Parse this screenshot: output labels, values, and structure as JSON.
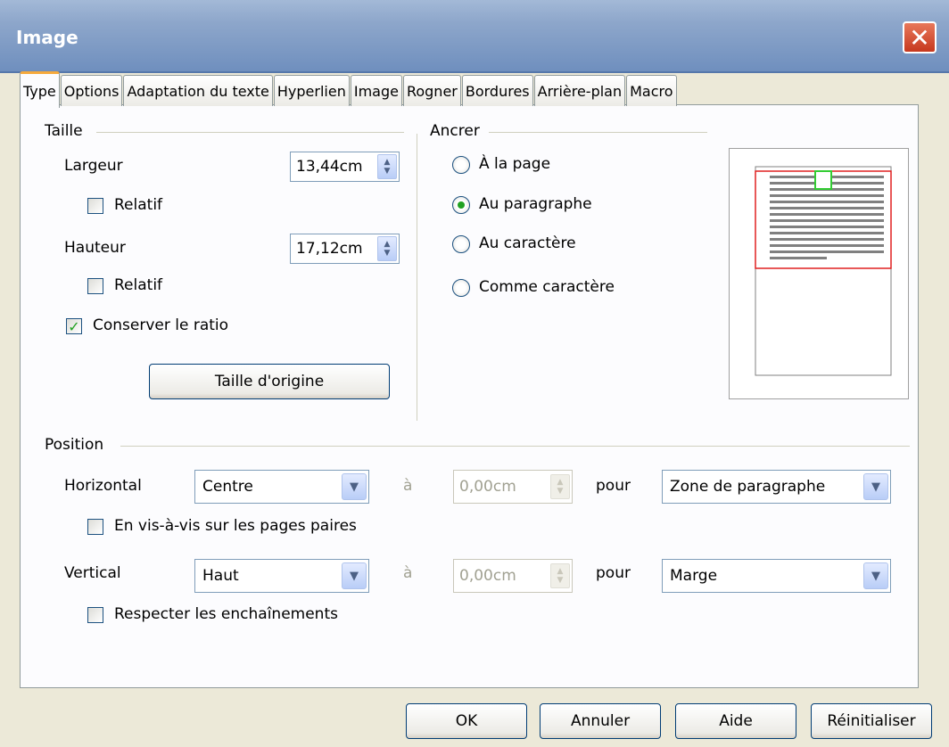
{
  "window": {
    "title": "Image",
    "close_glyph": "✕"
  },
  "tabs": [
    {
      "label": "Type",
      "active": true
    },
    {
      "label": "Options"
    },
    {
      "label": "Adaptation du texte"
    },
    {
      "label": "Hyperlien"
    },
    {
      "label": "Image"
    },
    {
      "label": "Rogner"
    },
    {
      "label": "Bordures"
    },
    {
      "label": "Arrière-plan"
    },
    {
      "label": "Macro"
    }
  ],
  "size": {
    "group_label": "Taille",
    "width_label": "Largeur",
    "width_value": "13,44cm",
    "width_relative_label": "Relatif",
    "width_relative_checked": false,
    "height_label": "Hauteur",
    "height_value": "17,12cm",
    "height_relative_label": "Relatif",
    "height_relative_checked": false,
    "keep_ratio_label": "Conserver le ratio",
    "keep_ratio_checked": true,
    "original_size_button": "Taille d'origine"
  },
  "anchor": {
    "group_label": "Ancrer",
    "options": [
      {
        "label": "À la page",
        "selected": false
      },
      {
        "label": "Au paragraphe",
        "selected": true
      },
      {
        "label": "Au caractère",
        "selected": false
      },
      {
        "label": "Comme caractère",
        "selected": false
      }
    ]
  },
  "position": {
    "group_label": "Position",
    "horizontal_label": "Horizontal",
    "horizontal_value": "Centre",
    "horizontal_at_label": "à",
    "horizontal_offset": "0,00cm",
    "horizontal_for_label": "pour",
    "horizontal_ref": "Zone de paragraphe",
    "mirror_label": "En vis-à-vis sur les pages paires",
    "mirror_checked": false,
    "vertical_label": "Vertical",
    "vertical_value": "Haut",
    "vertical_at_label": "à",
    "vertical_offset": "0,00cm",
    "vertical_for_label": "pour",
    "vertical_ref": "Marge",
    "follow_flow_label": "Respecter les enchaînements",
    "follow_flow_checked": false
  },
  "buttons": {
    "ok": "OK",
    "cancel": "Annuler",
    "help": "Aide",
    "reset": "Réinitialiser"
  },
  "colors": {
    "preview_frame": "#e02020",
    "preview_anchor": "#33cc33",
    "preview_lines": "#808080"
  },
  "icons": {
    "check": "✓",
    "spin_up": "▲",
    "spin_down": "▼",
    "dropdown": "▼"
  }
}
